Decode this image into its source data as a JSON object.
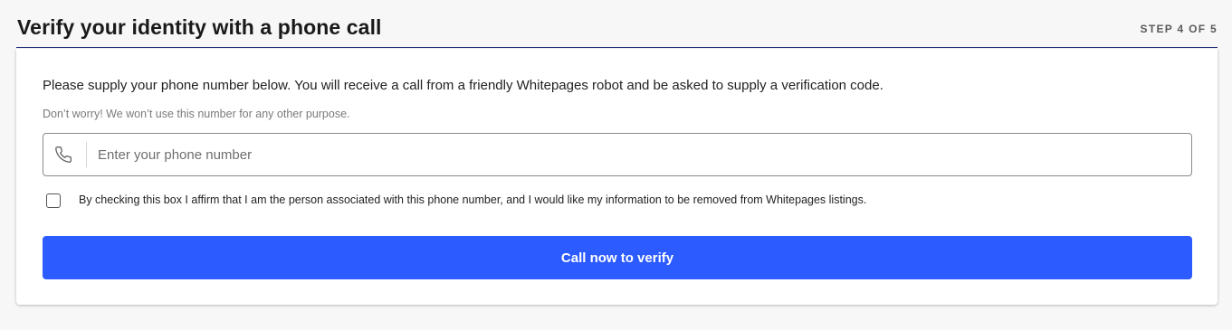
{
  "header": {
    "title": "Verify your identity with a phone call",
    "step": "STEP 4 OF 5"
  },
  "form": {
    "intro": "Please supply your phone number below. You will receive a call from a friendly Whitepages robot and be asked to supply a verification code.",
    "note": "Don’t worry! We won’t use this number for any other purpose.",
    "phone_icon": "phone-icon",
    "phone_value": "",
    "phone_placeholder": "Enter your phone number",
    "affirm_checked": false,
    "affirm_text": "By checking this box I affirm that I am the person associated with this phone number, and I would like my information to be removed from Whitepages listings.",
    "submit_label": "Call now to verify"
  },
  "colors": {
    "accent": "#2c5bff",
    "header_rule": "#1f2a7a",
    "page_background": "#f7f7f7"
  }
}
